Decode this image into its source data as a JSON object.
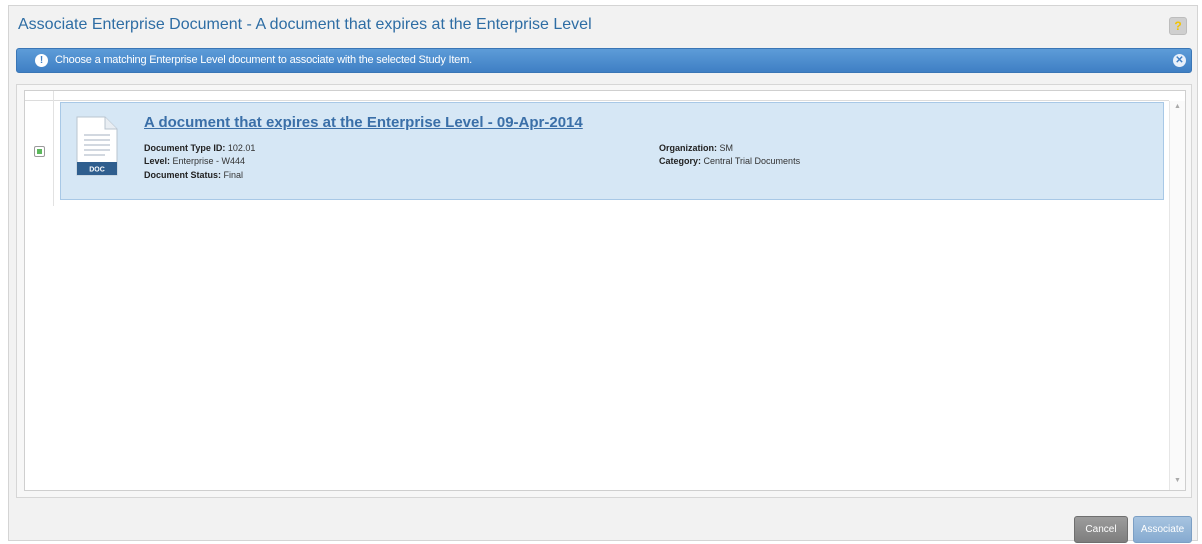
{
  "dialog": {
    "title": "Associate Enterprise Document - A document that expires at the Enterprise Level",
    "help_icon": "question-icon"
  },
  "info_bar": {
    "icon": "info-icon",
    "message": "Choose a matching Enterprise Level document to associate with the selected Study Item.",
    "close_icon": "close-circle-icon"
  },
  "document": {
    "title": "A document that expires at the Enterprise Level - 09-Apr-2014",
    "file_type": "DOC",
    "selected": true,
    "fields": {
      "type_id_label": "Document Type ID:",
      "type_id_value": "102.01",
      "level_label": "Level:",
      "level_value": "Enterprise - W444",
      "status_label": "Document Status:",
      "status_value": "Final",
      "organization_label": "Organization:",
      "organization_value": "SM",
      "category_label": "Category:",
      "category_value": "Central Trial Documents"
    }
  },
  "buttons": {
    "cancel": "Cancel",
    "associate": "Associate"
  },
  "colors": {
    "title": "#2e6da4",
    "info_bar": "#4a8bcf",
    "card_bg": "#d6e7f5",
    "checkbox_mark": "#5cb85c"
  }
}
